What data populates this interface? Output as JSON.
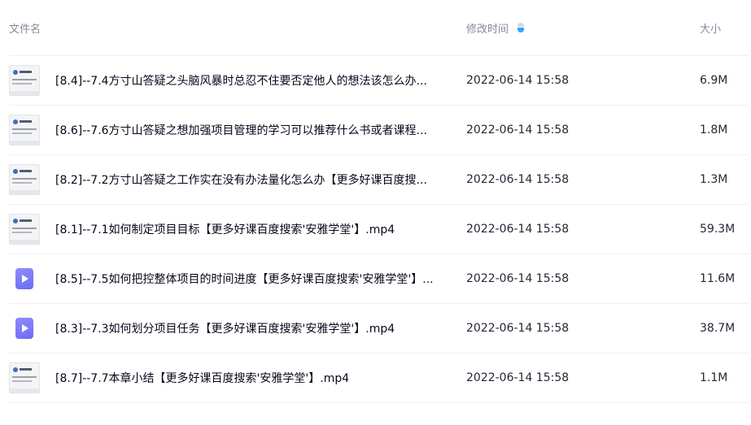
{
  "header": {
    "name_label": "文件名",
    "time_label": "修改时间",
    "size_label": "大小",
    "sort_icon": "sort-desc-icon"
  },
  "files": [
    {
      "name": "[8.4]--7.4方寸山答疑之头脑风暴时总忍不住要否定他人的想法该怎么办...",
      "modified": "2022-06-14 15:58",
      "size": "6.9M",
      "thumb": "doc-thumbnail"
    },
    {
      "name": "[8.6]--7.6方寸山答疑之想加强项目管理的学习可以推荐什么书或者课程...",
      "modified": "2022-06-14 15:58",
      "size": "1.8M",
      "thumb": "doc-thumbnail"
    },
    {
      "name": "[8.2]--7.2方寸山答疑之工作实在没有办法量化怎么办【更多好课百度搜...",
      "modified": "2022-06-14 15:58",
      "size": "1.3M",
      "thumb": "doc-thumbnail"
    },
    {
      "name": "[8.1]--7.1如何制定项目目标【更多好课百度搜索'安雅学堂'】.mp4",
      "modified": "2022-06-14 15:58",
      "size": "59.3M",
      "thumb": "doc-thumbnail"
    },
    {
      "name": "[8.5]--7.5如何把控整体项目的时间进度【更多好课百度搜索'安雅学堂'】...",
      "modified": "2022-06-14 15:58",
      "size": "11.6M",
      "thumb": "video-icon"
    },
    {
      "name": "[8.3]--7.3如何划分项目任务【更多好课百度搜索'安雅学堂'】.mp4",
      "modified": "2022-06-14 15:58",
      "size": "38.7M",
      "thumb": "video-icon"
    },
    {
      "name": "[8.7]--7.7本章小结【更多好课百度搜索'安雅学堂'】.mp4",
      "modified": "2022-06-14 15:58",
      "size": "1.1M",
      "thumb": "doc-thumbnail"
    }
  ]
}
